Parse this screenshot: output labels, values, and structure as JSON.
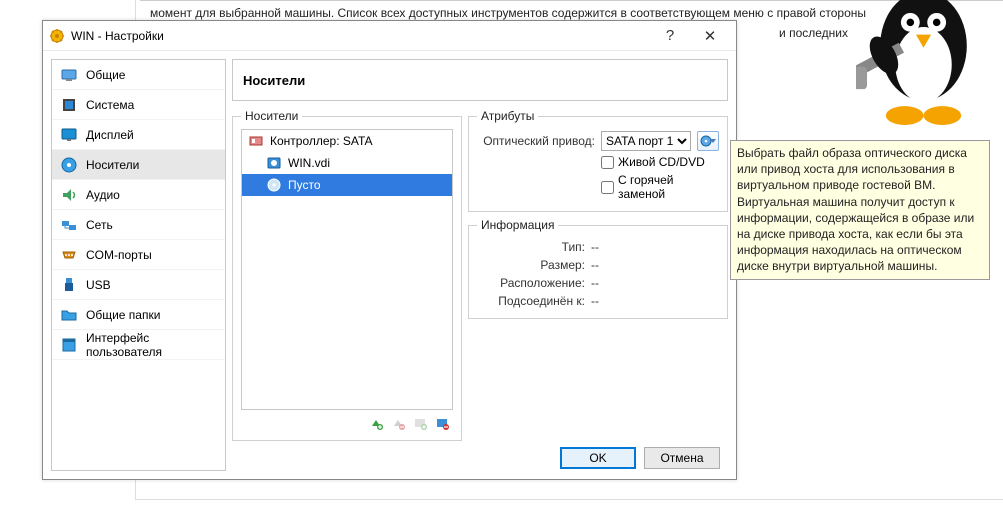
{
  "background": {
    "topText": "момент для выбранной машины. Список всех доступных инструментов содержится в соответствующем меню с правой стороны",
    "sideText": "и последних"
  },
  "dialog": {
    "title": "WIN - Настройки",
    "help": "?",
    "close": "✕"
  },
  "sidebar": {
    "items": [
      {
        "label": "Общие",
        "icon": "general"
      },
      {
        "label": "Система",
        "icon": "system"
      },
      {
        "label": "Дисплей",
        "icon": "display"
      },
      {
        "label": "Носители",
        "icon": "storage",
        "selected": true
      },
      {
        "label": "Аудио",
        "icon": "audio"
      },
      {
        "label": "Сеть",
        "icon": "network"
      },
      {
        "label": "COM-порты",
        "icon": "serial"
      },
      {
        "label": "USB",
        "icon": "usb"
      },
      {
        "label": "Общие папки",
        "icon": "folders"
      },
      {
        "label": "Интерфейс пользователя",
        "icon": "ui"
      }
    ]
  },
  "storage": {
    "panelTitle": "Носители",
    "treeLegend": "Носители",
    "attrLegend": "Атрибуты",
    "infoLegend": "Информация",
    "controller": "Контроллер: SATA",
    "item1": "WIN.vdi",
    "item2": "Пусто",
    "driveLabel": "Оптический привод:",
    "driveValue": "SATA порт 1",
    "liveCD": "Живой CD/DVD",
    "hotplug": "С горячей заменой",
    "info": {
      "typeLabel": "Тип:",
      "typeVal": "--",
      "sizeLabel": "Размер:",
      "sizeVal": "--",
      "locLabel": "Расположение:",
      "locVal": "--",
      "attachedLabel": "Подсоединён к:",
      "attachedVal": "--"
    }
  },
  "buttons": {
    "ok": "OK",
    "cancel": "Отмена"
  },
  "tooltip": "Выбрать файл образа оптического диска или привод хоста для использования в виртуальном приводе гостевой ВМ. Виртуальная машина получит доступ к информации, содержащейся в образе или на диске привода хоста, как если бы эта информация находилась на оптическом диске внутри виртуальной машины."
}
